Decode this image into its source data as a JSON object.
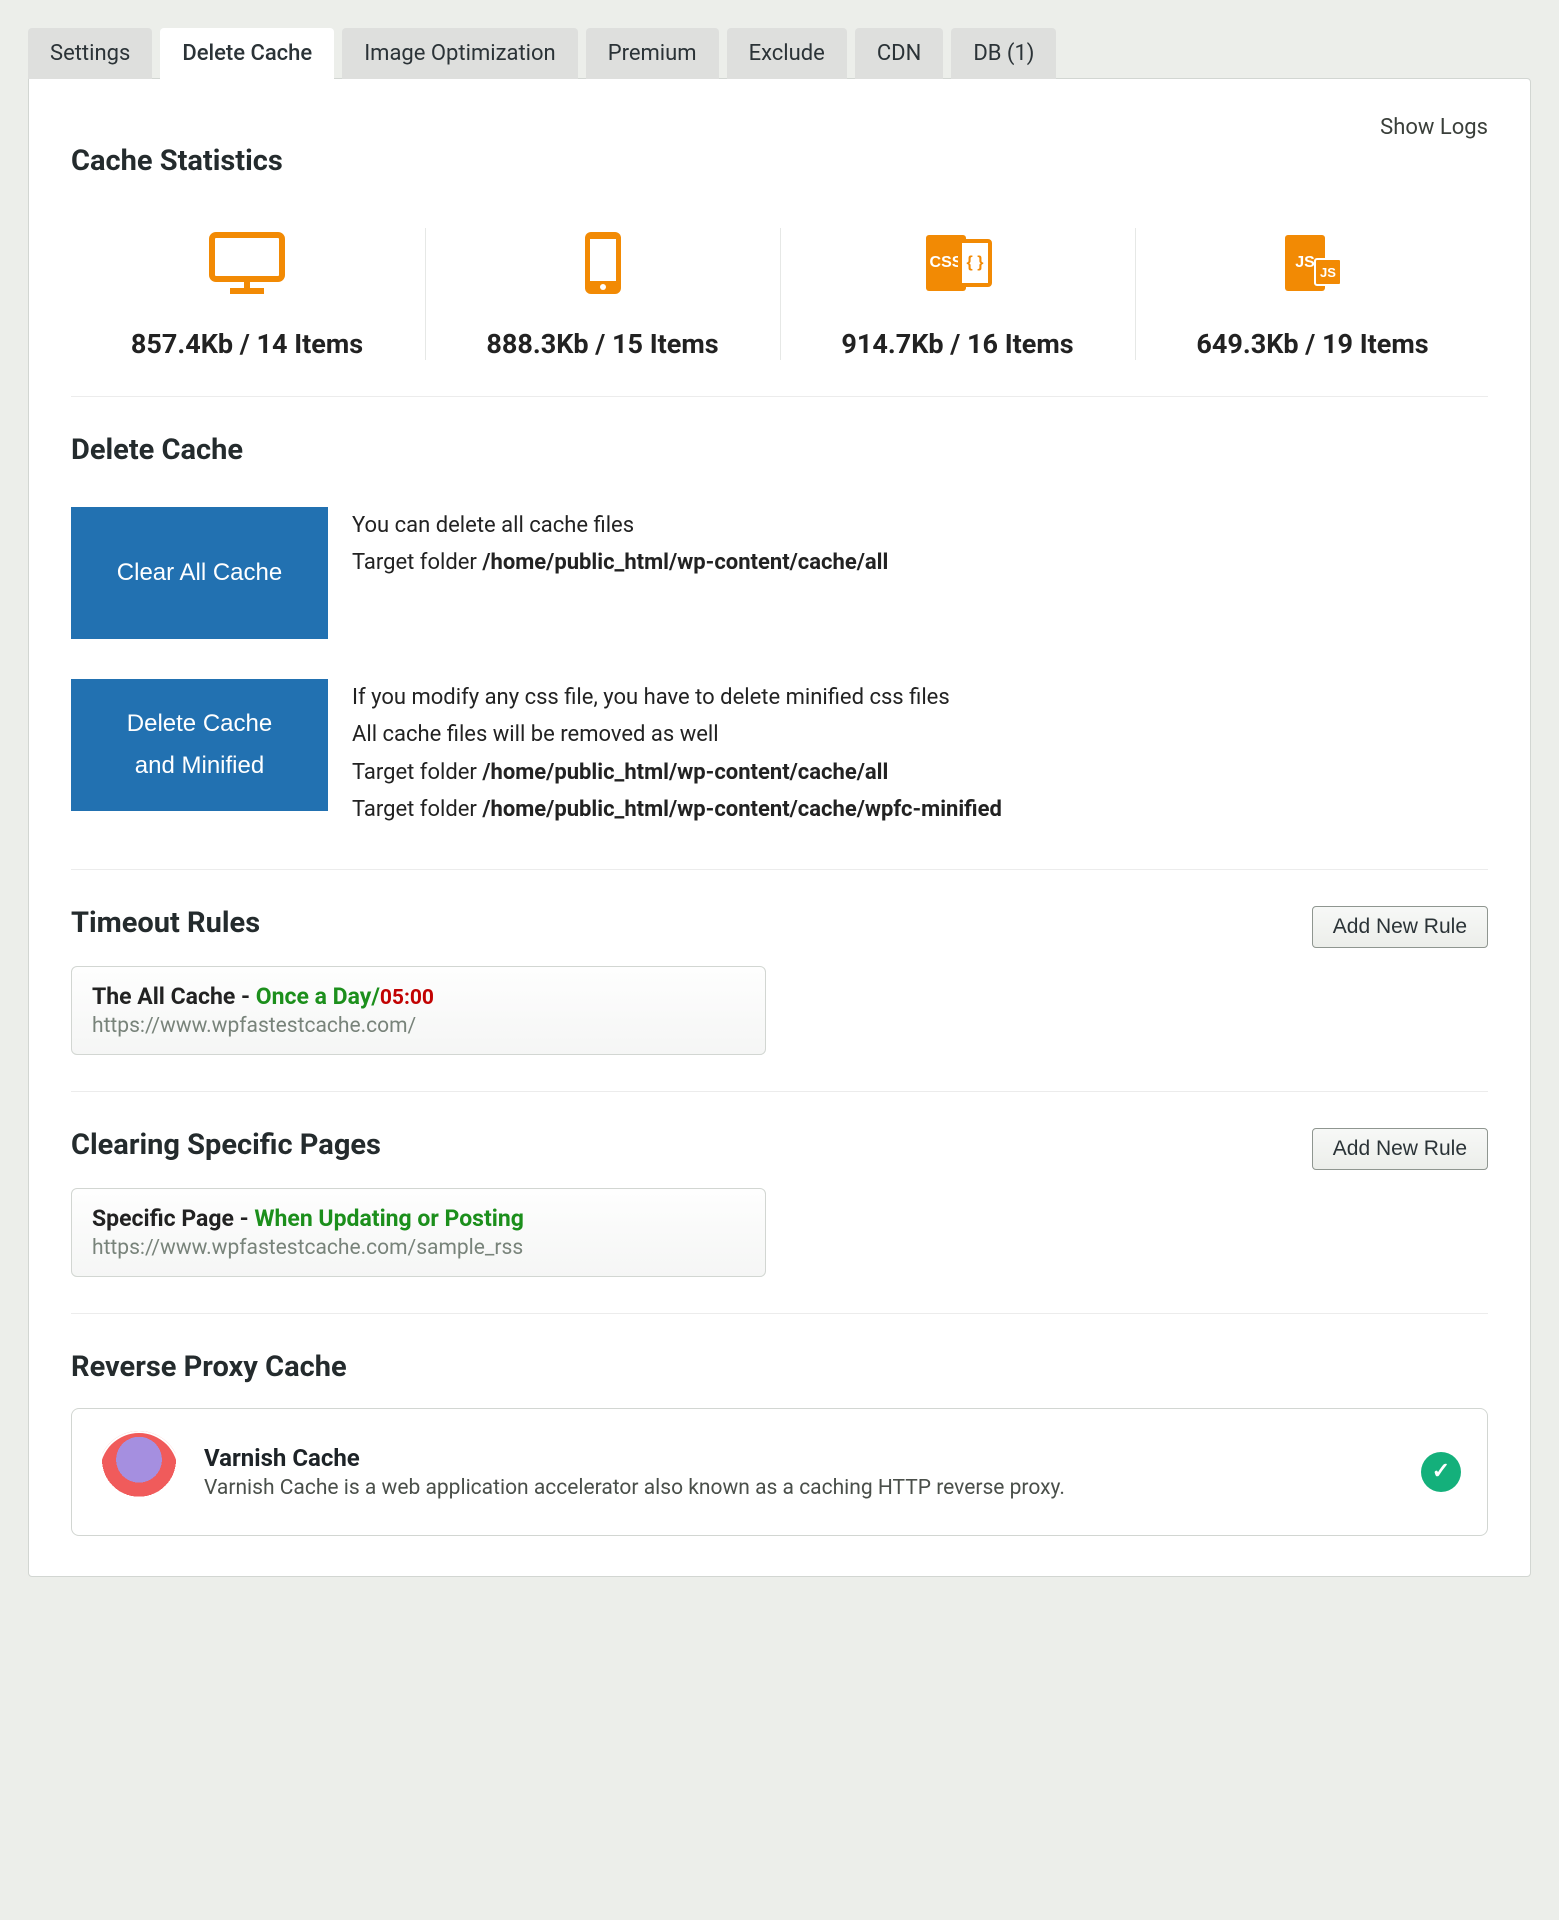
{
  "tabs": [
    {
      "label": "Settings"
    },
    {
      "label": "Delete Cache"
    },
    {
      "label": "Image Optimization"
    },
    {
      "label": "Premium"
    },
    {
      "label": "Exclude"
    },
    {
      "label": "CDN"
    },
    {
      "label": "DB (1)"
    }
  ],
  "active_tab_index": 1,
  "show_logs": "Show Logs",
  "sections": {
    "cache_stats": "Cache Statistics",
    "delete_cache": "Delete Cache",
    "timeout_rules": "Timeout Rules",
    "clearing_specific": "Clearing Specific Pages",
    "reverse_proxy": "Reverse Proxy Cache"
  },
  "stats": [
    {
      "icon": "desktop",
      "label": "857.4Kb / 14 Items"
    },
    {
      "icon": "mobile",
      "label": "888.3Kb / 15 Items"
    },
    {
      "icon": "css",
      "label": "914.7Kb / 16 Items"
    },
    {
      "icon": "js",
      "label": "649.3Kb / 19 Items"
    }
  ],
  "actions": {
    "clear_all": {
      "button": "Clear All Cache",
      "line1": "You can delete all cache files",
      "target_prefix": "Target folder ",
      "target_path": "/home/public_html/wp-content/cache/all"
    },
    "delete_minified": {
      "button_line1": "Delete Cache",
      "button_line2": "and Minified",
      "line1": "If you modify any css file, you have to delete minified css files",
      "line2": "All cache files will be removed as well",
      "target_prefix": "Target folder ",
      "target_path1": "/home/public_html/wp-content/cache/all",
      "target_path2": "/home/public_html/wp-content/cache/wpfc-minified"
    }
  },
  "add_rule_label": "Add New Rule",
  "timeout_rule": {
    "prefix": "The All Cache - ",
    "freq": "Once a Day",
    "slash": "/",
    "time": "05:00",
    "url": "https://www.wpfastestcache.com/"
  },
  "specific_rule": {
    "prefix": "Specific Page - ",
    "cond": "When Updating or Posting",
    "url": "https://www.wpfastestcache.com/sample_rss"
  },
  "proxy": {
    "title": "Varnish Cache",
    "desc": "Varnish Cache is a web application accelerator also known as a caching HTTP reverse proxy.",
    "status_icon": "check"
  },
  "colors": {
    "accent": "#2271b1",
    "icon_orange": "#f28a04"
  }
}
